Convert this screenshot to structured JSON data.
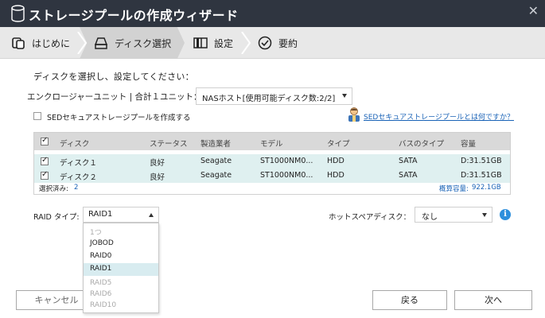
{
  "window": {
    "title": "ストレージプールの作成ウィザード",
    "close_icon": "close-icon"
  },
  "steps": [
    {
      "label": "はじめに",
      "icon": "start-icon"
    },
    {
      "label": "ディスク選択",
      "icon": "disk-icon"
    },
    {
      "label": "設定",
      "icon": "settings-icon"
    },
    {
      "label": "要約",
      "icon": "check-circle-icon"
    }
  ],
  "instruction": "ディスクを選択し、設定してください：",
  "enclosure": {
    "label": "エンクロージャーユニット | 合計１ユニット：",
    "value": "NASホスト[使用可能ディスク数:2/2]"
  },
  "sed": {
    "checkbox_label": "SEDセキュアストレージプールを作成する",
    "link_text": "SEDセキュアストレージプールとは何ですか？"
  },
  "table": {
    "headers": [
      "ディスク",
      "ステータス",
      "製造業者",
      "モデル",
      "タイプ",
      "バスのタイプ",
      "容量"
    ],
    "rows": [
      {
        "checked": true,
        "cells": [
          "ディスク１",
          "良好",
          "Seagate",
          "ST1000NM0...",
          "HDD",
          "SATA",
          "D:31.51GB"
        ]
      },
      {
        "checked": true,
        "cells": [
          "ディスク２",
          "良好",
          "Seagate",
          "ST1000NM0...",
          "HDD",
          "SATA",
          "D:31.51GB"
        ]
      }
    ],
    "footer_selected_label": "選択済み:",
    "footer_selected_count": "2",
    "footer_capacity_label": "概算容量:",
    "footer_capacity_value": "922.1GB"
  },
  "raid": {
    "label": "RAID タイプ:",
    "value": "RAID1",
    "options": [
      {
        "label": "1つ",
        "disabled": true
      },
      {
        "label": "JOBOD",
        "disabled": false
      },
      {
        "label": "RAID0",
        "disabled": false
      },
      {
        "label": "RAID1",
        "disabled": false,
        "selected": true
      },
      {
        "label": "RAID5",
        "disabled": true
      },
      {
        "label": "RAID6",
        "disabled": true
      },
      {
        "label": "RAID10",
        "disabled": true
      }
    ]
  },
  "spare": {
    "label": "ホットスペアディスク：",
    "value": "なし"
  },
  "buttons": {
    "cancel": "キャンセル",
    "back": "戻る",
    "next": "次へ"
  },
  "colors": {
    "titlebar": "#2f3540",
    "row_bg": "#dff0f0",
    "link": "#1a63b7",
    "info": "#2d8fdc"
  }
}
